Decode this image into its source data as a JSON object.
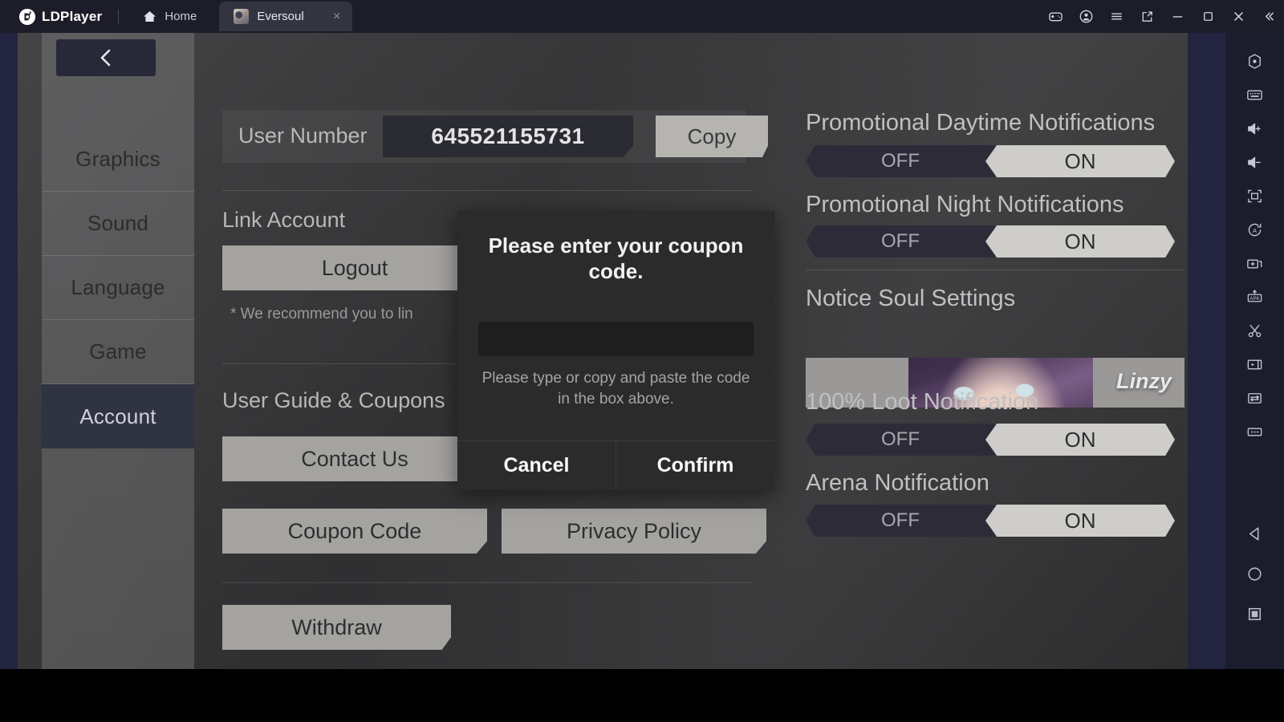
{
  "titlebar": {
    "app_name": "LDPlayer",
    "logo_glyph": "⬤",
    "tabs": [
      {
        "label": "Home",
        "icon": "home-icon",
        "active": false
      },
      {
        "label": "Eversoul",
        "icon": "app-thumbnail",
        "active": true,
        "close": "×"
      }
    ],
    "controls": [
      {
        "name": "gamepad-icon"
      },
      {
        "name": "account-icon"
      },
      {
        "name": "menu-icon"
      },
      {
        "name": "share-icon"
      },
      {
        "name": "minimize-icon"
      },
      {
        "name": "maximize-icon"
      },
      {
        "name": "close-icon"
      },
      {
        "name": "collapse-icon"
      }
    ]
  },
  "rail": {
    "tools": [
      {
        "name": "settings-gear-icon"
      },
      {
        "name": "keyboard-mapping-icon"
      },
      {
        "name": "volume-up-icon"
      },
      {
        "name": "volume-down-icon"
      },
      {
        "name": "fullscreen-icon"
      },
      {
        "name": "auto-rotate-icon"
      },
      {
        "name": "multi-instance-icon"
      },
      {
        "name": "install-apk-icon"
      },
      {
        "name": "screenshot-scissors-icon"
      },
      {
        "name": "video-record-icon"
      },
      {
        "name": "shared-folder-icon"
      },
      {
        "name": "more-options-icon"
      }
    ],
    "nav": [
      {
        "name": "android-back-icon"
      },
      {
        "name": "android-home-icon"
      },
      {
        "name": "android-recents-icon"
      }
    ]
  },
  "game_menu": {
    "back_label": "‹",
    "items": [
      {
        "label": "Graphics",
        "active": false
      },
      {
        "label": "Sound",
        "active": false
      },
      {
        "label": "Language",
        "active": false
      },
      {
        "label": "Game",
        "active": false
      },
      {
        "label": "Account",
        "active": true
      }
    ]
  },
  "account": {
    "user_number_label": "User Number",
    "user_number_value": "645521155731",
    "copy_label": "Copy",
    "link_account_title": "Link Account",
    "logout_label": "Logout",
    "link_note": "* We recommend you to lin",
    "guide_title": "User Guide & Coupons",
    "contact_label": "Contact Us",
    "coupon_label": "Coupon Code",
    "privacy_label": "Privacy Policy",
    "withdraw_label": "Withdraw"
  },
  "notifications": [
    {
      "title": "Promotional Daytime Notifications",
      "off_label": "OFF",
      "on_label": "ON",
      "value": "ON"
    },
    {
      "title": "Promotional Night Notifications",
      "off_label": "OFF",
      "on_label": "ON",
      "value": "ON"
    },
    {
      "title": "100% Loot Notification",
      "off_label": "OFF",
      "on_label": "ON",
      "value": "ON"
    },
    {
      "title": "Arena Notification",
      "off_label": "OFF",
      "on_label": "ON",
      "value": "ON"
    }
  ],
  "notice_soul": {
    "title": "Notice Soul Settings",
    "character_name": "Linzy"
  },
  "modal": {
    "title": "Please enter your coupon code.",
    "input_value": "",
    "hint": "Please type or copy and paste the code in the box above.",
    "cancel_label": "Cancel",
    "confirm_label": "Confirm"
  },
  "colors": {
    "titlebar_bg": "#1c1d28",
    "rail_bg": "#1b1d2c",
    "emulator_edge": "#232440",
    "game_bg": "#3a3a3c",
    "menu_active": "#2f3342",
    "button_face": "#a5a3a0",
    "toggle_on": "#cfcdca",
    "toggle_off": "#2e2b39",
    "modal_bg": "#2b2b2b"
  }
}
